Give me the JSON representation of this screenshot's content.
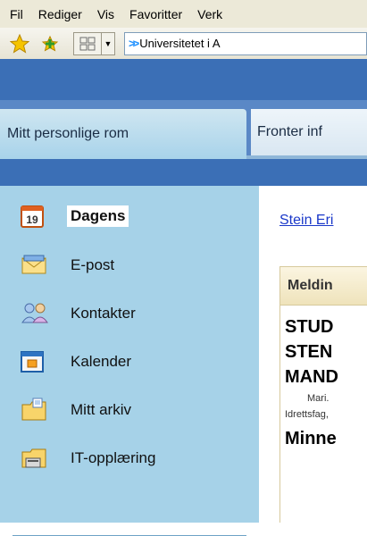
{
  "menu": {
    "items": [
      "Fil",
      "Rediger",
      "Vis",
      "Favoritter",
      "Verk"
    ]
  },
  "toolbar": {
    "favorites_icon": "star-icon",
    "add_favorite_icon": "add-star-icon",
    "view_icon": "grid-view-icon",
    "address_text": "Universitetet i A"
  },
  "tabs": {
    "active_label": "Mitt personlige rom",
    "other_label": "Fronter inf"
  },
  "sidebar": {
    "items": [
      {
        "label": "Dagens",
        "icon": "calendar-day-icon",
        "calendar_number": "19"
      },
      {
        "label": "E-post",
        "icon": "envelope-icon"
      },
      {
        "label": "Kontakter",
        "icon": "contacts-icon"
      },
      {
        "label": "Kalender",
        "icon": "calendar-icon"
      },
      {
        "label": "Mitt arkiv",
        "icon": "folder-icon"
      },
      {
        "label": "IT-opplæring",
        "icon": "training-folder-icon"
      }
    ]
  },
  "main": {
    "user_link": "Stein Eri",
    "panel_title": "Meldin",
    "headline_lines": [
      "STUD",
      "STEN",
      "MAND"
    ],
    "author": "Mari.",
    "category": "Idrettsfag,",
    "headline2": "Minne"
  },
  "colors": {
    "tab_bar": "#3b6fb6",
    "sidebar": "#a6d2e8",
    "link": "#1a38c9"
  }
}
